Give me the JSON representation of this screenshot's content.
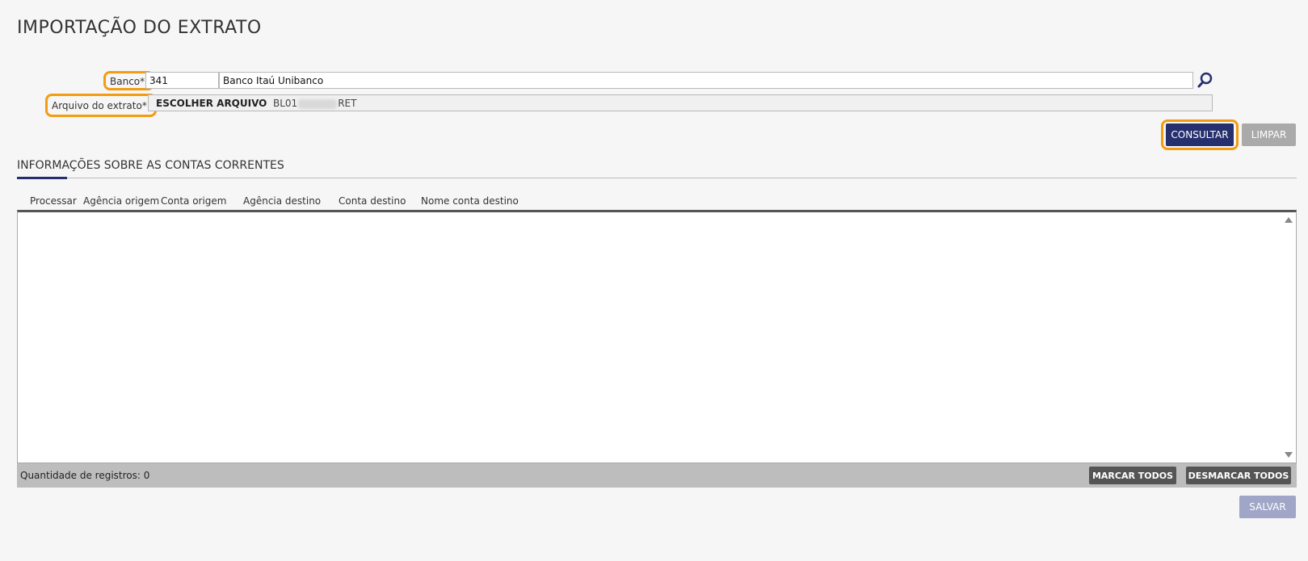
{
  "page": {
    "title": "IMPORTAÇÃO DO EXTRATO"
  },
  "form": {
    "bank_label": "Banco*:",
    "bank_code": "341",
    "bank_name": "Banco Itaú Unibanco",
    "file_label": "Arquivo do extrato*:",
    "file_button": "ESCOLHER ARQUIVO",
    "file_name_prefix": "BL01",
    "file_name_suffix": "RET"
  },
  "actions": {
    "consultar": "CONSULTAR",
    "limpar": "LIMPAR",
    "salvar": "SALVAR"
  },
  "section": {
    "title": "INFORMAÇÕES SOBRE AS CONTAS CORRENTES"
  },
  "table": {
    "columns": [
      "Processar",
      "Agência origem",
      "Conta origem",
      "Agência destino",
      "Conta destino",
      "Nome conta destino"
    ]
  },
  "footer": {
    "quantity": "Quantidade de registros: 0",
    "mark_all": "MARCAR TODOS",
    "unmark_all": "DESMARCAR TODOS"
  },
  "colors": {
    "primary": "#27306e",
    "highlight": "#f39c12",
    "disabled": "#aaaaaa"
  }
}
